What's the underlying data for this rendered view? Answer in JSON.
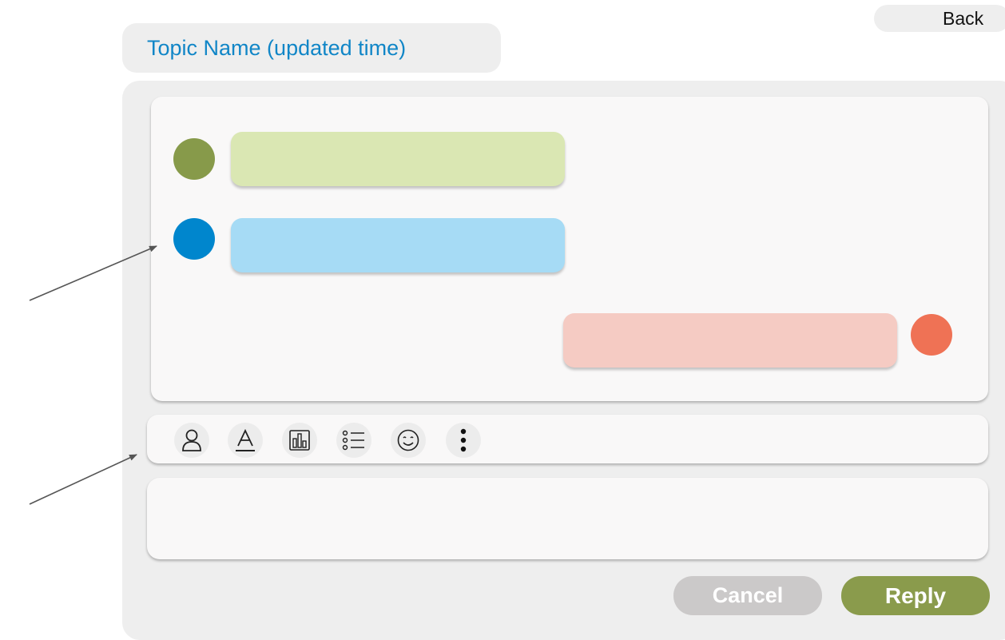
{
  "header": {
    "back_label": "Back",
    "topic_title": "Topic Name (updated time)"
  },
  "conversation": {
    "messages": [
      {
        "side": "left",
        "avatar_color": "#879a4a",
        "bubble_color": "#dae7b3",
        "text": ""
      },
      {
        "side": "left",
        "avatar_color": "#0086cd",
        "bubble_color": "#a6dbf5",
        "text": ""
      },
      {
        "side": "right",
        "avatar_color": "#ef7255",
        "bubble_color": "#f5cbc3",
        "text": ""
      }
    ]
  },
  "toolbar": {
    "tools": [
      {
        "name": "mention",
        "icon": "person-icon"
      },
      {
        "name": "text-format",
        "icon": "text-format-icon"
      },
      {
        "name": "chart",
        "icon": "bar-chart-icon"
      },
      {
        "name": "list",
        "icon": "bulleted-list-icon"
      },
      {
        "name": "emoji",
        "icon": "smiley-icon"
      },
      {
        "name": "more",
        "icon": "more-vertical-icon"
      }
    ]
  },
  "reply": {
    "value": "",
    "placeholder": ""
  },
  "actions": {
    "cancel_label": "Cancel",
    "reply_label": "Reply"
  },
  "colors": {
    "accent": "#1186c7",
    "reply_button": "#8a9b4c",
    "cancel_button": "#cbc9c9",
    "panel_background": "#eeeeee",
    "card_background": "#f9f8f8"
  }
}
